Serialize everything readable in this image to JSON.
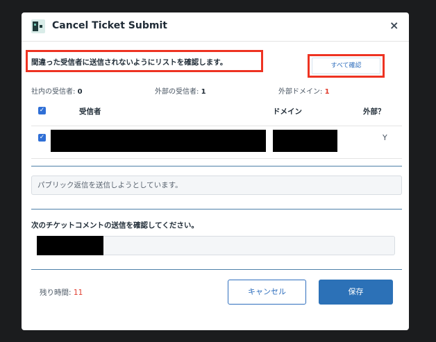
{
  "dialog": {
    "title": "Cancel Ticket Submit",
    "close_glyph": "×",
    "app_icon": "ticket-app-icon"
  },
  "warning": {
    "text": "間違った受信者に送信されないようにリストを確認します。",
    "confirm_all_label": "すべて確認"
  },
  "stats": {
    "internal_label": "社内の受信者:",
    "internal_count": "0",
    "external_label": "外部の受信者:",
    "external_count": "1",
    "external_domain_label": "外部ドメイン:",
    "external_domain_count": "1"
  },
  "table": {
    "headers": {
      "recipient": "受信者",
      "domain": "ドメイン",
      "external": "外部？"
    },
    "rows": [
      {
        "external": "Y",
        "checked": true
      }
    ]
  },
  "notice": "パブリック返信を送信しようとしています。",
  "comment": {
    "confirm_text": "次のチケットコメントの送信を確認してください。"
  },
  "footer": {
    "timer_label": "残り時間:",
    "timer_value": "11",
    "cancel_label": "キャンセル",
    "save_label": "保存"
  },
  "colors": {
    "accent": "#2c71b7",
    "alert": "#e03b2c",
    "highlight_border": "#ee3322"
  }
}
